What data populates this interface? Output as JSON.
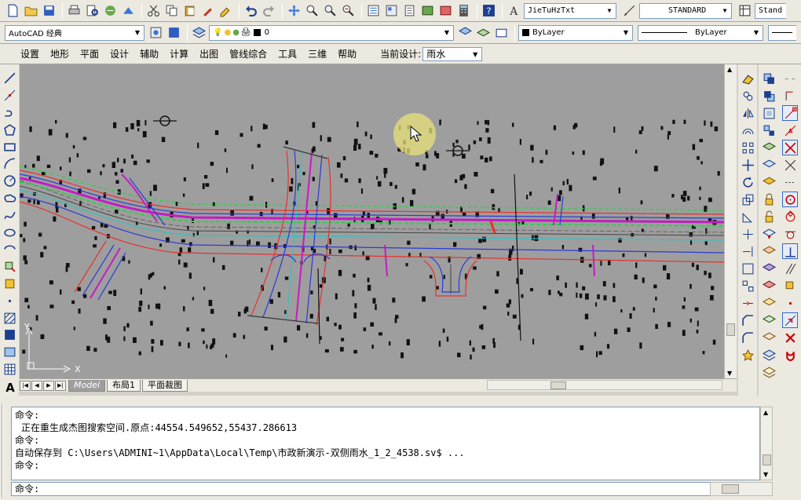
{
  "toolbar_top": {
    "text_style": "JieTuHzTxt",
    "dim_style": "STANDARD",
    "table_style": "Stand"
  },
  "toolbar_second": {
    "workspace": "AutoCAD 经典",
    "layer": "0",
    "color": "ByLayer",
    "linetype": "ByLayer"
  },
  "menu": {
    "items": [
      "设置",
      "地形",
      "平面",
      "设计",
      "辅助",
      "计算",
      "出图",
      "管线综合",
      "工具",
      "三维",
      "帮助"
    ],
    "current_design_label": "当前设计:",
    "current_design_value": "雨水"
  },
  "drawing": {
    "axis_x": "X",
    "axis_y": "Y"
  },
  "layout_tabs": {
    "tabs": [
      "Model",
      "布局1",
      "平面裁图"
    ]
  },
  "command": {
    "lines": [
      "命令:",
      "正在重生成杰图搜索空间.原点:44554.549652,55437.286613",
      "命令:",
      "自动保存到 C:\\Users\\ADMINI~1\\AppData\\Local\\Temp\\市政新演示-双侧雨水_1_2_4538.sv$ ...",
      "命令:"
    ],
    "prompt": "命令:"
  },
  "colors": {
    "canvas_bg": "#9e9e9e",
    "road_red": "#e8302c",
    "road_blue": "#2a39d6",
    "road_magenta": "#c41cc4",
    "road_green": "#2bd24a",
    "road_cyan": "#22c7c7"
  }
}
